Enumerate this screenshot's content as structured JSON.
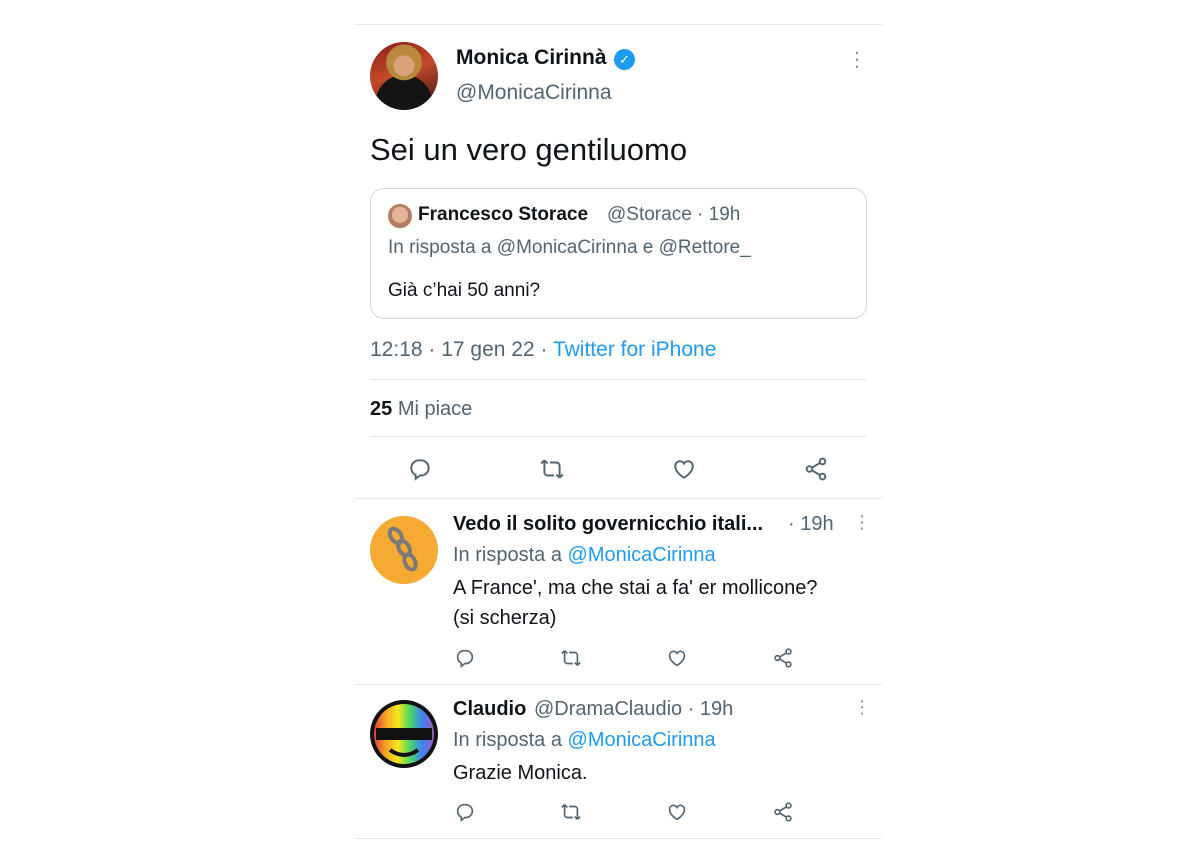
{
  "main_tweet": {
    "author_name": "Monica Cirinnà",
    "author_handle": "@MonicaCirinna",
    "text": "Sei un vero gentiluomo",
    "quoted": {
      "author_name": "Francesco Storace",
      "author_handle": "@Storace",
      "time": "19h",
      "reply_to_prefix": "In risposta a",
      "reply_to": "@MonicaCirinna e @Rettore_",
      "text": "Già c’hai 50 anni?"
    },
    "time": "12:18",
    "date": "17 gen 22",
    "source": "Twitter for iPhone",
    "likes_count": "25",
    "likes_label": "Mi piace"
  },
  "replies": [
    {
      "author_name": "Vedo il solito governicchio itali...",
      "time": "19h",
      "reply_to_prefix": "In risposta a",
      "reply_to": "@MonicaCirinna",
      "text_lines": [
        "A France', ma che stai a fa' er mollicone?",
        "(si scherza)"
      ]
    },
    {
      "author_name": "Claudio",
      "author_handle": "@DramaClaudio",
      "time": "19h",
      "reply_to_prefix": "In risposta a",
      "reply_to": "@MonicaCirinna",
      "text_lines": [
        "Grazie Monica."
      ]
    }
  ],
  "icons": {
    "reply": "reply-icon",
    "retweet": "retweet-icon",
    "like": "heart-icon",
    "share": "share-icon",
    "more": "more-icon",
    "verified": "verified-badge-icon"
  },
  "colors": {
    "accent": "#1d9bf0",
    "text_primary": "#0f1419",
    "text_secondary": "#536471",
    "divider": "#e6e9eb"
  }
}
